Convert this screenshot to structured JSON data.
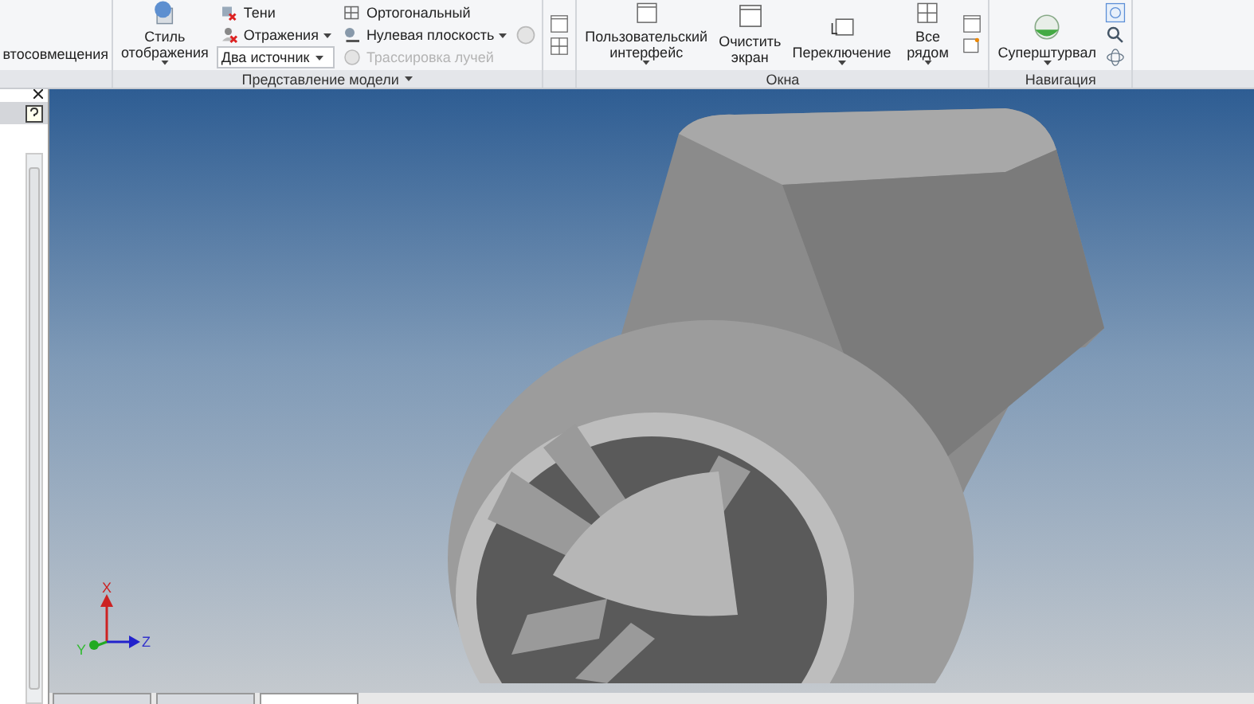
{
  "ribbon": {
    "partial_group": {
      "label": "втосовмещения"
    },
    "groups": [
      {
        "label": "Представление модели",
        "dropdown": true,
        "columns": [
          [
            {
              "kind": "large",
              "label": "Стиль отображения",
              "dropdown": true
            }
          ],
          [
            {
              "kind": "small",
              "label": "Тени",
              "dropdown": false,
              "disabled": false
            },
            {
              "kind": "small",
              "label": "Отражения",
              "dropdown": true,
              "disabled": false
            },
            {
              "kind": "combo",
              "value": "Два источник"
            }
          ],
          [
            {
              "kind": "small",
              "label": "Ортогональный",
              "dropdown": false,
              "disabled": false
            },
            {
              "kind": "small",
              "label": "Нулевая плоскость",
              "dropdown": true,
              "disabled": false
            },
            {
              "kind": "small",
              "label": "Трассировка лучей",
              "dropdown": false,
              "disabled": true
            }
          ],
          [
            {
              "kind": "icon"
            }
          ]
        ]
      },
      {
        "dropdown": false,
        "columns": [
          [
            {
              "kind": "icon"
            },
            {
              "kind": "icon"
            }
          ]
        ]
      },
      {
        "label": "Окна",
        "dropdown": false,
        "columns": [
          [
            {
              "kind": "large",
              "label": "Пользовательский интерфейс",
              "dropdown": true
            }
          ],
          [
            {
              "kind": "large",
              "label": "Очистить экран",
              "dropdown": false
            }
          ],
          [
            {
              "kind": "large",
              "label": "Переключение",
              "dropdown": true
            }
          ],
          [
            {
              "kind": "large",
              "label": "Все рядом",
              "dropdown": true
            }
          ],
          [
            {
              "kind": "icon"
            },
            {
              "kind": "icon"
            }
          ]
        ]
      },
      {
        "label": "Навигация",
        "dropdown": false,
        "columns": [
          [
            {
              "kind": "large",
              "label": "Суперштурвал",
              "dropdown": true
            }
          ],
          [
            {
              "kind": "icon"
            },
            {
              "kind": "icon"
            },
            {
              "kind": "icon"
            }
          ]
        ]
      }
    ]
  },
  "viewport": {
    "axes": {
      "x": "X",
      "y": "Y",
      "z": "Z"
    }
  },
  "document_tabs": [
    {
      "selected": false
    },
    {
      "selected": false
    },
    {
      "selected": true
    }
  ]
}
